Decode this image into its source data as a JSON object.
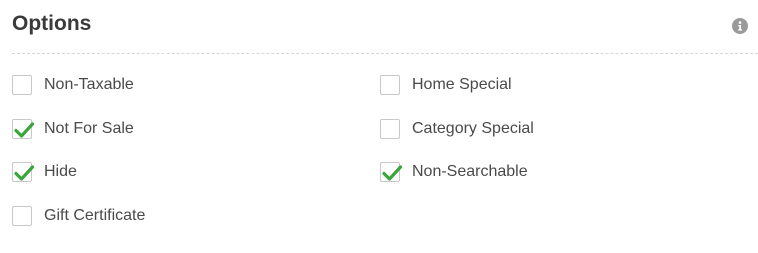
{
  "header": {
    "title": "Options",
    "info_icon": "info-circle-icon"
  },
  "colors": {
    "check": "#3aa63a",
    "border": "#c8c8c8",
    "divider": "#d6d6d6"
  },
  "options": [
    {
      "label": "Non-Taxable",
      "checked": false
    },
    {
      "label": "Not For Sale",
      "checked": true
    },
    {
      "label": "Hide",
      "checked": true
    },
    {
      "label": "Gift Certificate",
      "checked": false
    },
    {
      "label": "Home Special",
      "checked": false
    },
    {
      "label": "Category Special",
      "checked": false
    },
    {
      "label": "Non-Searchable",
      "checked": true
    }
  ]
}
